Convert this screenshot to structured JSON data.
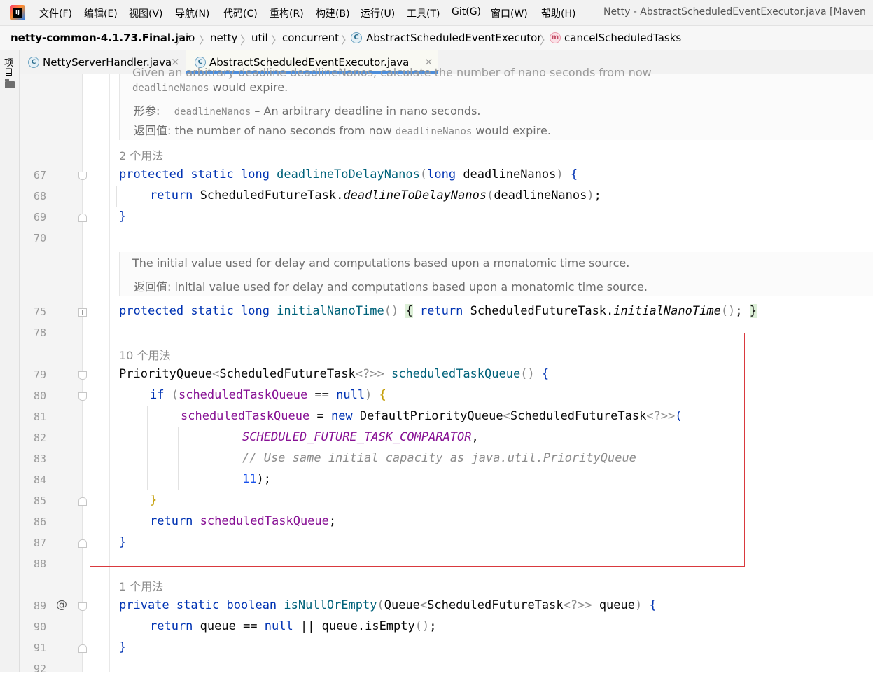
{
  "menu": {
    "items": [
      "文件(F)",
      "编辑(E)",
      "视图(V)",
      "导航(N)",
      "代码(C)",
      "重构(R)",
      "构建(B)",
      "运行(U)",
      "工具(T)",
      "Git(G)",
      "窗口(W)",
      "帮助(H)"
    ],
    "window_title": "Netty - AbstractScheduledEventExecutor.java [Maven"
  },
  "breadcrumb": {
    "jar": "netty-common-4.1.73.Final.jar",
    "pkg1": "io",
    "pkg2": "netty",
    "pkg3": "util",
    "pkg4": "concurrent",
    "class": "AbstractScheduledEventExecutor",
    "method": "cancelScheduledTasks",
    "class_icon": "C",
    "method_icon": "m"
  },
  "toolstrip": {
    "project": "项目"
  },
  "tabs": [
    {
      "label": "NettyServerHandler.java",
      "icon": "C",
      "close": "×"
    },
    {
      "label": "AbstractScheduledEventExecutor.java",
      "icon": "C",
      "close": "×"
    }
  ],
  "doc1": {
    "cut_top": "Given an arbitrary deadline deadlineNanos, calculate the number of nano seconds from now",
    "line1_code": "deadlineNanos",
    "line1_text": " would expire.",
    "param_tag": "形参:",
    "param_code": "deadlineNanos",
    "param_text": " – An arbitrary deadline in nano seconds.",
    "return_tag": "返回值:",
    "return_text": " the number of nano seconds from now ",
    "return_code": "deadlineNanos",
    "return_text2": " would expire."
  },
  "doc2": {
    "line1": "The initial value used for delay and computations based upon a monatomic time source.",
    "return_tag": "返回值:",
    "return_text": " initial value used for delay and computations based upon a monatomic time source."
  },
  "usages": {
    "u1": "2 个用法",
    "u2": "10 个用法",
    "u3": "1 个用法"
  },
  "line_numbers": [
    "67",
    "68",
    "69",
    "70",
    "75",
    "78",
    "79",
    "80",
    "81",
    "82",
    "83",
    "84",
    "85",
    "86",
    "87",
    "88",
    "89",
    "90",
    "91",
    "92"
  ],
  "code": {
    "l67": {
      "kw": "protected static long ",
      "fn": "deadlineToDelayNanos",
      "p1": "(",
      "kw2": "long",
      "arg": " deadlineNanos",
      "p2": ")",
      "b": " {"
    },
    "l68": {
      "kw": "return ",
      "cls": "ScheduledFutureTask.",
      "fn": "deadlineToDelayNanos",
      "p1": "(",
      "arg": "deadlineNanos",
      "p2": ")",
      "end": ";"
    },
    "l69": "}",
    "l75": {
      "kw": "protected static long ",
      "fn": "initialNanoTime",
      "p": "()",
      "b1": "{",
      "kw2": " return ",
      "cls": "ScheduledFutureTask.",
      "fn2": "initialNanoTime",
      "p2": "()",
      "end": ";",
      "b2": "}"
    },
    "l79": {
      "t1": "PriorityQueue",
      "g1": "<",
      "t2": "ScheduledFutureTask",
      "g2": "<?>>",
      "fn": " scheduledTaskQueue",
      "p": "()",
      "b": " {"
    },
    "l80": {
      "kw": "if ",
      "p1": "(",
      "fld": "scheduledTaskQueue",
      "op": " == ",
      "kw2": "null",
      "p2": ")",
      "b": " {"
    },
    "l81": {
      "fld": "scheduledTaskQueue",
      "op": " = ",
      "kw": "new ",
      "t1": "DefaultPriorityQueue",
      "g1": "<",
      "t2": "ScheduledFutureTask",
      "g2": "<?>>",
      "p": "("
    },
    "l82": {
      "st": "SCHEDULED_FUTURE_TASK_COMPARATOR",
      "c": ","
    },
    "l83": "// Use same initial capacity as java.util.PriorityQueue",
    "l84": {
      "num": "11",
      "end": ");"
    },
    "l85": "}",
    "l86": {
      "kw": "return ",
      "fld": "scheduledTaskQueue",
      "end": ";"
    },
    "l87": "}",
    "l89": {
      "kw": "private static boolean ",
      "fn": "isNullOrEmpty",
      "p1": "(",
      "t1": "Queue",
      "g1": "<",
      "t2": "ScheduledFutureTask",
      "g2": "<?>>",
      "arg": " queue",
      "p2": ")",
      "b": " {"
    },
    "l90": {
      "kw": "return ",
      "a": "queue == ",
      "kw2": "null",
      "b": " || queue.",
      "fn": "isEmpty",
      "p": "()",
      "end": ";"
    },
    "l91": "}"
  },
  "gutter": {
    "override_marker": "@"
  },
  "colors": {
    "keyword": "#0033b3",
    "method": "#00627a",
    "field": "#871094",
    "comment": "#8c8c8c",
    "highlight_box": "#d9393e",
    "tab_underline": "#4c8ddb"
  }
}
